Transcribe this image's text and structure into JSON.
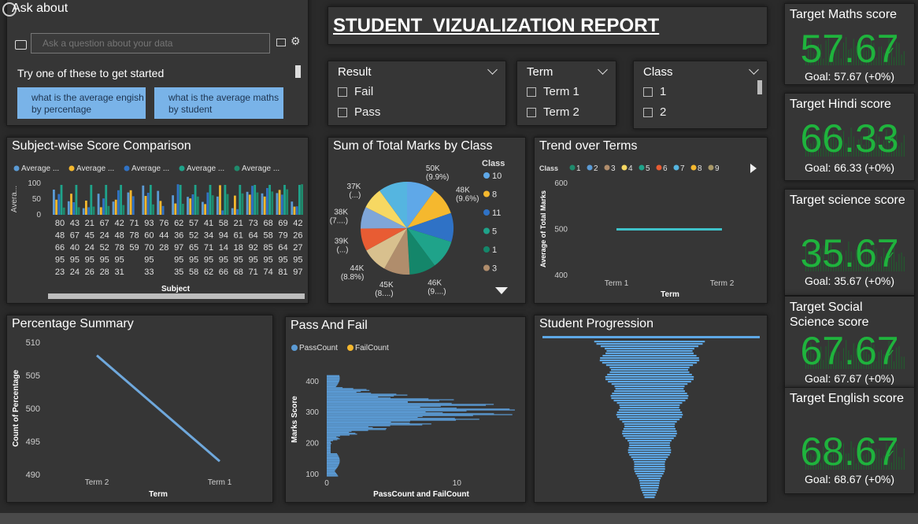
{
  "qa": {
    "title": "Ask about",
    "placeholder": "Ask a question about your data",
    "subtitle": "Try one of these to get started",
    "suggestions": [
      "what is the average engish by percentage",
      "what is the average maths by student"
    ]
  },
  "report_title": "STUDENT  VIZUALIZATION REPORT",
  "slicers": {
    "result": {
      "title": "Result",
      "options": [
        "Fail",
        "Pass"
      ]
    },
    "term": {
      "title": "Term",
      "options": [
        "Term 1",
        "Term 2"
      ]
    },
    "class": {
      "title": "Class",
      "options": [
        "1",
        "2"
      ]
    }
  },
  "kpis": [
    {
      "title": "Target Maths score",
      "value": "57.67",
      "goal": "Goal: 57.67 (+0%)"
    },
    {
      "title": "Target Hindi score",
      "value": "66.33",
      "goal": "Goal: 66.33 (+0%)"
    },
    {
      "title": "Target science score",
      "value": "35.67",
      "goal": "Goal: 35.67 (+0%)"
    },
    {
      "title": "Target Social Science score",
      "value": "67.67",
      "goal": "Goal: 67.67 (+0%)"
    },
    {
      "title": "Target English score",
      "value": "68.67",
      "goal": "Goal: 68.67 (+0%)"
    }
  ],
  "colors": {
    "blue": "#5b9bd5",
    "yellow": "#f5b82e",
    "navy": "#3072c4",
    "teal": "#1fa38a",
    "green": "#1f8a6c",
    "kpi_green": "#1fb33d"
  },
  "chart_data": [
    {
      "type": "table",
      "title": "Subject-wise Score Comparison",
      "legend": [
        "Average ...",
        "Average ...",
        "Average ...",
        "Average ...",
        "Average ..."
      ],
      "ylabel": "Avera...",
      "xlabel": "Subject",
      "yticks": [
        100,
        50,
        0
      ],
      "columns": 16,
      "rows": [
        [
          "80",
          "43",
          "21",
          "67",
          "42",
          "71",
          "93",
          "76",
          "62",
          "57",
          "41",
          "58",
          "21",
          "73",
          "68",
          "69",
          "42"
        ],
        [
          "48",
          "67",
          "45",
          "24",
          "48",
          "78",
          "60",
          "44",
          "36",
          "52",
          "34",
          "94",
          "61",
          "64",
          "58",
          "79",
          "26"
        ],
        [
          "66",
          "40",
          "24",
          "52",
          "78",
          "59",
          "70",
          "28",
          "97",
          "65",
          "71",
          "14",
          "18",
          "92",
          "85",
          "64",
          "27"
        ],
        [
          "95",
          "95",
          "95",
          "95",
          "95",
          "",
          "95",
          "",
          "95",
          "95",
          "95",
          "95",
          "95",
          "95",
          "95",
          "95",
          "95"
        ],
        [
          "23",
          "24",
          "26",
          "28",
          "31",
          "",
          "33",
          "",
          "35",
          "58",
          "62",
          "66",
          "68",
          "71",
          "74",
          "81",
          "97"
        ]
      ]
    },
    {
      "type": "pie",
      "title": "Sum of Total Marks by Class",
      "legend_title": "Class",
      "legend": [
        "10",
        "8",
        "11",
        "5",
        "1",
        "3"
      ],
      "slices": [
        {
          "label": "10",
          "value": 50,
          "text": "50K (9.9%)"
        },
        {
          "label": "8",
          "value": 48,
          "text": "48K (9.6%)"
        },
        {
          "label": "11",
          "value": 50,
          "text": ""
        },
        {
          "label": "5",
          "value": 50,
          "text": ""
        },
        {
          "label": "1",
          "value": 46,
          "text": "46K (9....)"
        },
        {
          "label": "3",
          "value": 45,
          "text": "45K (8....)"
        },
        {
          "label": "4",
          "value": 44,
          "text": "44K (8.8%)"
        },
        {
          "label": "2",
          "value": 39,
          "text": "39K (...)"
        },
        {
          "label": "6",
          "value": 38,
          "text": "38K (7....)"
        },
        {
          "label": "7",
          "value": 37,
          "text": "37K (...)"
        },
        {
          "label": "9",
          "value": 50,
          "text": ""
        }
      ]
    },
    {
      "type": "line",
      "title": "Trend over Terms",
      "legend_title": "Class",
      "legend": [
        "1",
        "2",
        "3",
        "4",
        "5",
        "6",
        "7",
        "8",
        "9"
      ],
      "x": [
        "Term 1",
        "Term 2"
      ],
      "y": [
        500,
        500
      ],
      "ylim": [
        400,
        600
      ],
      "yticks": [
        600,
        500,
        400
      ],
      "xlabel": "Term",
      "ylabel": "Average of Total Marks"
    },
    {
      "type": "line",
      "title": "Percentage Summary",
      "x": [
        "Term 2",
        "Term 1"
      ],
      "y": [
        508,
        492
      ],
      "ylim": [
        490,
        510
      ],
      "yticks": [
        510,
        505,
        500,
        495,
        490
      ],
      "xlabel": "Term",
      "ylabel": "Count of Percentage"
    },
    {
      "type": "bar",
      "title": "Pass And Fail",
      "legend": [
        "PassCount",
        "FailCount"
      ],
      "ylabel": "Marks Score",
      "xlabel": "PassCount and FailCount",
      "yticks": [
        400,
        300,
        200,
        100
      ],
      "xticks": [
        0,
        10
      ],
      "ylim": [
        90,
        430
      ],
      "xlim": [
        0,
        15
      ]
    },
    {
      "type": "bar",
      "title": "Student Progression"
    }
  ]
}
